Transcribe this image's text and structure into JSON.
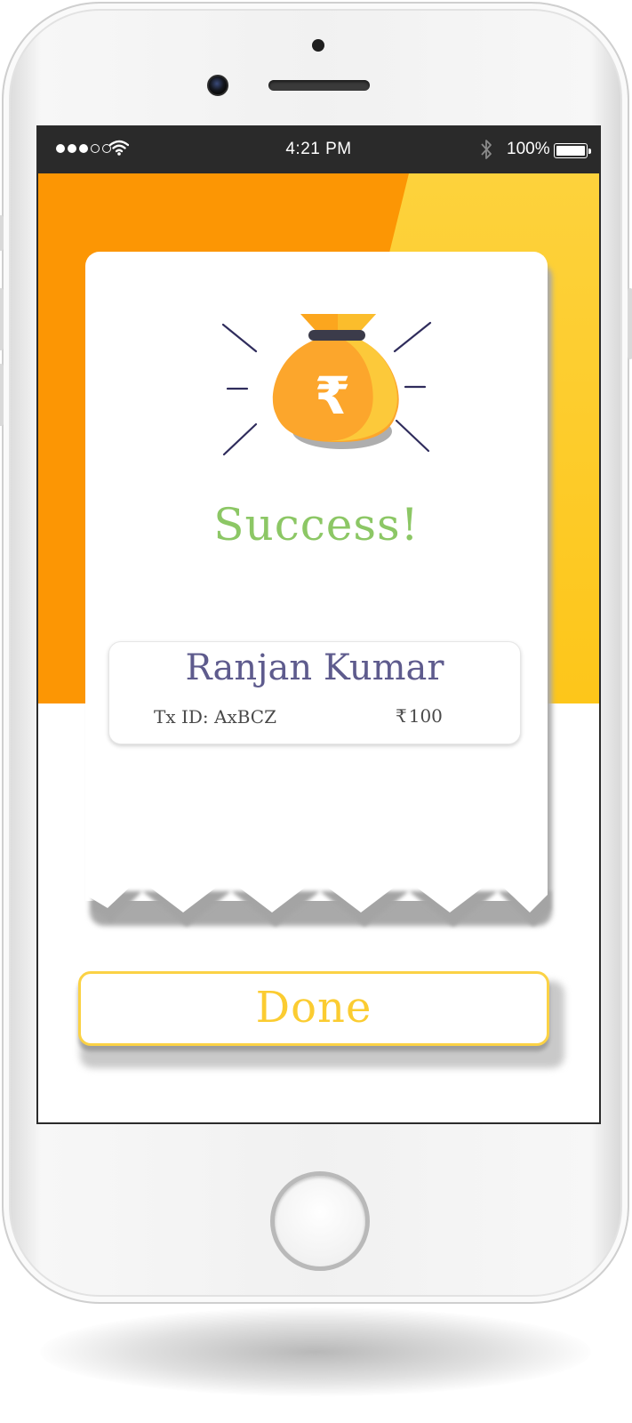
{
  "status_bar": {
    "time": "4:21 PM",
    "battery": "100%",
    "signal_bars_filled": 3,
    "signal_bars_total": 5
  },
  "result": {
    "title": "Success!",
    "recipient_name": "Ranjan Kumar",
    "tx_id_label": "Tx ID: AxBCZ",
    "currency_symbol": "₹",
    "amount": "100"
  },
  "actions": {
    "done_label": "Done"
  },
  "icons": {
    "illustration": "rupee-money-bag-icon"
  },
  "colors": {
    "header_orange": "#fc9604",
    "header_yellow": "#fdc61a",
    "success_green": "#8cc765",
    "name_purple": "#5e5b8d",
    "done_yellow": "#fbcc31"
  }
}
